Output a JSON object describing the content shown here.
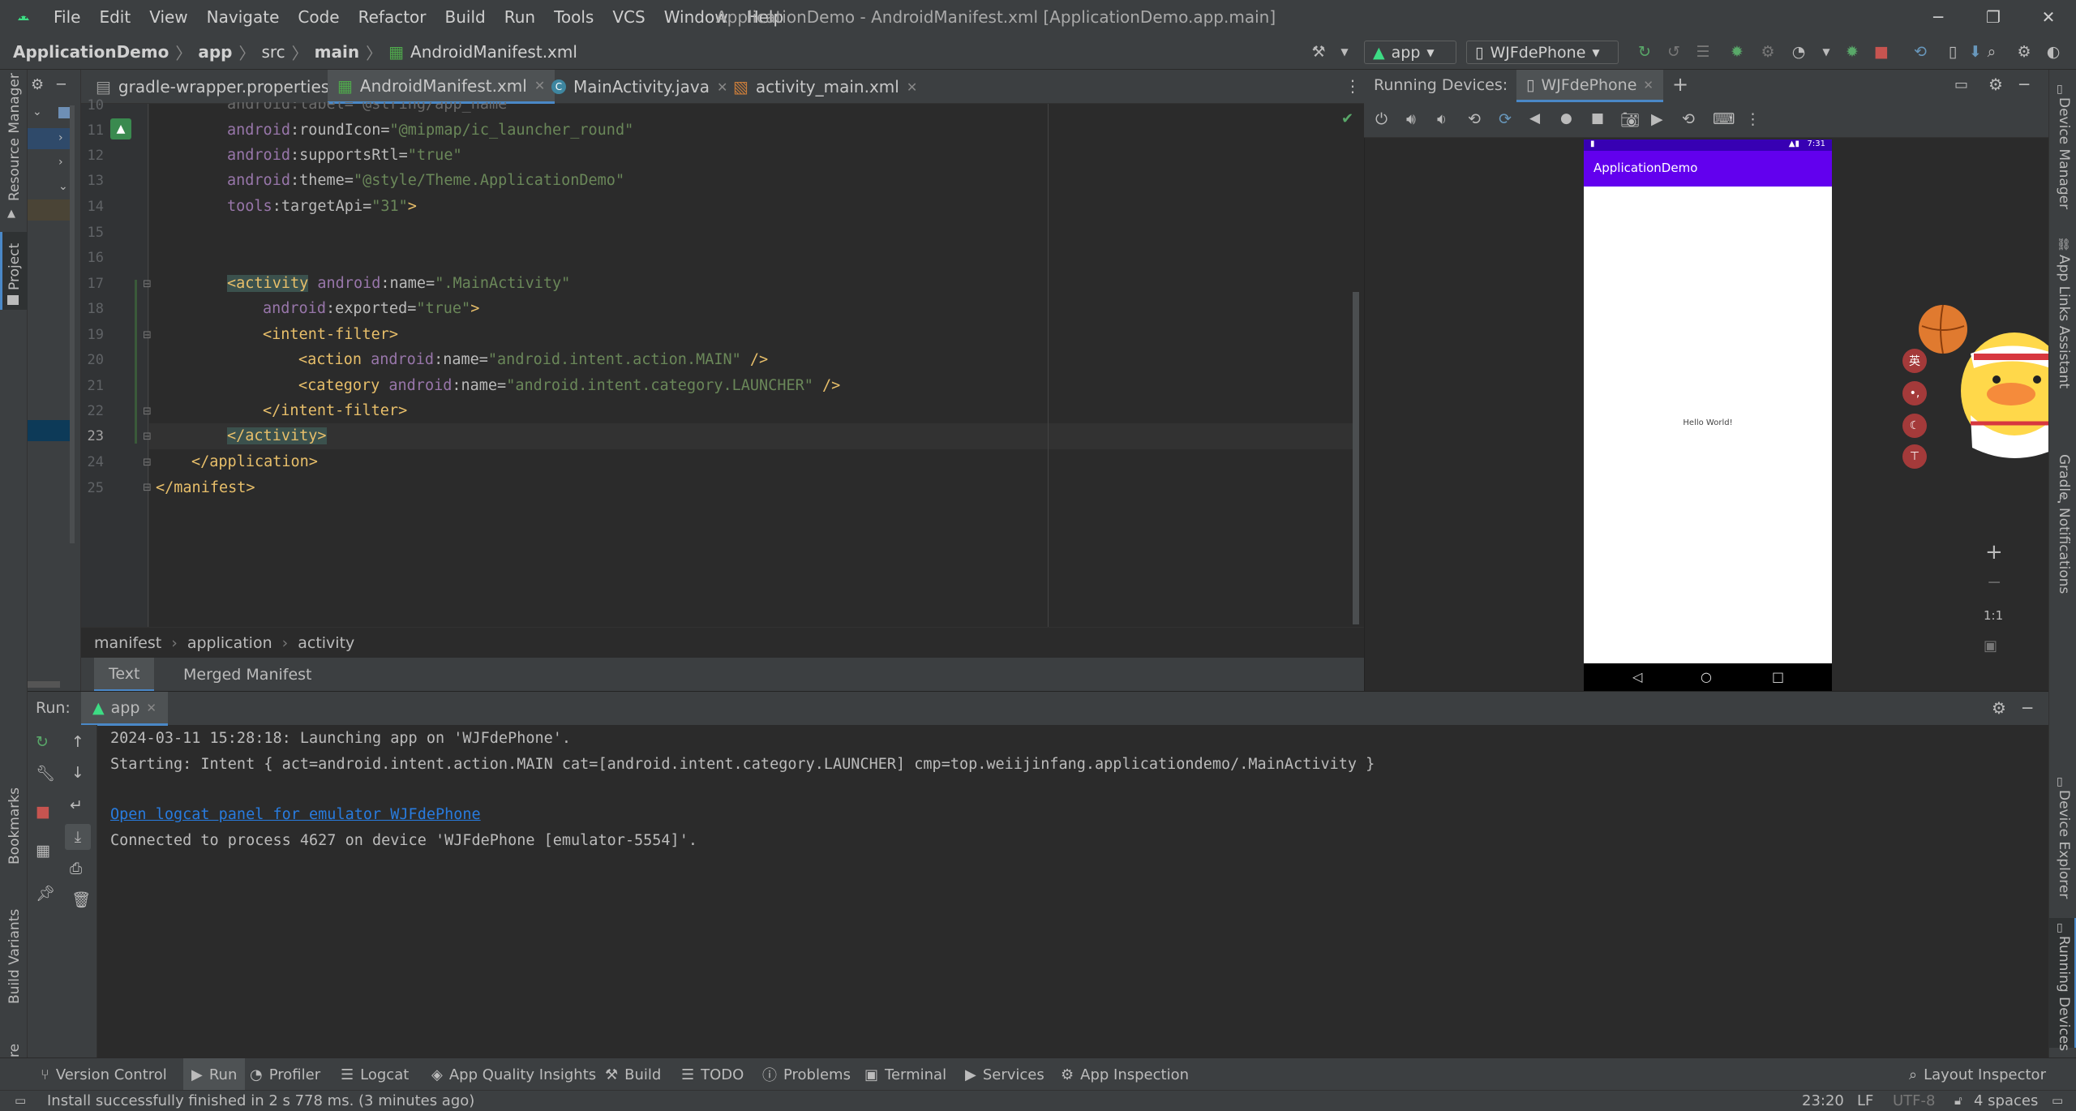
{
  "window": {
    "title": "ApplicationDemo - AndroidManifest.xml [ApplicationDemo.app.main]",
    "menu": [
      "File",
      "Edit",
      "View",
      "Navigate",
      "Code",
      "Refactor",
      "Build",
      "Run",
      "Tools",
      "VCS",
      "Window",
      "Help"
    ]
  },
  "breadcrumb": {
    "project": "ApplicationDemo",
    "module": "app",
    "src": "src",
    "main": "main",
    "file": "AndroidManifest.xml"
  },
  "toolbar": {
    "run_config": "app",
    "device": "WJFdePhone"
  },
  "left_strip": {
    "resource_manager": "Resource Manager",
    "project": "Project",
    "bookmarks": "Bookmarks",
    "build_variants": "Build Variants",
    "structure": "Structure"
  },
  "right_strip": {
    "device_manager": "Device Manager",
    "app_links": "App Links Assistant",
    "gradle": "Gradle",
    "notifications": "Notifications",
    "device_explorer": "Device Explorer",
    "running_devices": "Running Devices"
  },
  "editor": {
    "tabs": [
      "gradle-wrapper.properties",
      "AndroidManifest.xml",
      "MainActivity.java",
      "activity_main.xml"
    ],
    "active_tab": "AndroidManifest.xml",
    "lines": [
      {
        "n": "10",
        "partial": true,
        "text": "android:label=\"@string/app_name\""
      },
      {
        "n": "11"
      },
      {
        "n": "12"
      },
      {
        "n": "13"
      },
      {
        "n": "14"
      },
      {
        "n": "15"
      },
      {
        "n": "16"
      },
      {
        "n": "17"
      },
      {
        "n": "18"
      },
      {
        "n": "19"
      },
      {
        "n": "20"
      },
      {
        "n": "21"
      },
      {
        "n": "22"
      },
      {
        "n": "23"
      },
      {
        "n": "24"
      },
      {
        "n": "25"
      }
    ],
    "code": {
      "l11a": "android",
      "l11b": ":roundIcon=",
      "l11c": "\"@mipmap/ic_launcher_round\"",
      "l12a": "android",
      "l12b": ":supportsRtl=",
      "l12c": "\"true\"",
      "l13a": "android",
      "l13b": ":theme=",
      "l13c": "\"@style/Theme.ApplicationDemo\"",
      "l14a": "tools",
      "l14b": ":targetApi=",
      "l14c": "\"31\"",
      "l14d": ">",
      "l17a": "<activity",
      "l17b": "android",
      "l17c": ":name=",
      "l17d": "\".MainActivity\"",
      "l18a": "android",
      "l18b": ":exported=",
      "l18c": "\"true\"",
      "l18d": ">",
      "l19a": "<intent-filter>",
      "l20a": "<action ",
      "l20b": "android",
      "l20c": ":name=",
      "l20d": "\"android.intent.action.MAIN\"",
      "l20e": " />",
      "l21a": "<category ",
      "l21b": "android",
      "l21c": ":name=",
      "l21d": "\"android.intent.category.LAUNCHER\"",
      "l21e": " />",
      "l22a": "</intent-filter>",
      "l23a": "</activity>",
      "l24a": "</application>",
      "l25a": "</manifest>"
    },
    "breadcrumb": [
      "manifest",
      "application",
      "activity"
    ],
    "bottom_tabs": [
      "Text",
      "Merged Manifest"
    ]
  },
  "running_devices": {
    "label": "Running Devices:",
    "device_tab": "WJFdePhone",
    "phone": {
      "time": "7:31",
      "app_title": "ApplicationDemo",
      "content": "Hello World!"
    },
    "zoom": {
      "plus": "+",
      "minus": "−",
      "one": "1:1"
    }
  },
  "run_panel": {
    "label": "Run:",
    "tab": "app",
    "lines": [
      "2024-03-11 15:28:18: Launching app on 'WJFdePhone'.",
      "Starting: Intent { act=android.intent.action.MAIN cat=[android.intent.category.LAUNCHER] cmp=top.weiijinfang.applicationdemo/.MainActivity }",
      "Open logcat panel for emulator WJFdePhone",
      "Connected to process 4627 on device 'WJFdePhone [emulator-5554]'."
    ]
  },
  "bottom_tools": [
    "Version Control",
    "Run",
    "Profiler",
    "Logcat",
    "App Quality Insights",
    "Build",
    "TODO",
    "Problems",
    "Terminal",
    "Services",
    "App Inspection"
  ],
  "layout_inspector": "Layout Inspector",
  "status": {
    "message": "Install successfully finished in 2 s 778 ms. (3 minutes ago)",
    "position": "23:20",
    "line_sep": "LF",
    "encoding": "UTF-8",
    "indent": "4 spaces"
  },
  "colors": {
    "accent": "#4a88c7",
    "purple": "#6200ee",
    "tag": "#e8bf6a",
    "attr": "#9876aa",
    "string": "#6a8759"
  }
}
